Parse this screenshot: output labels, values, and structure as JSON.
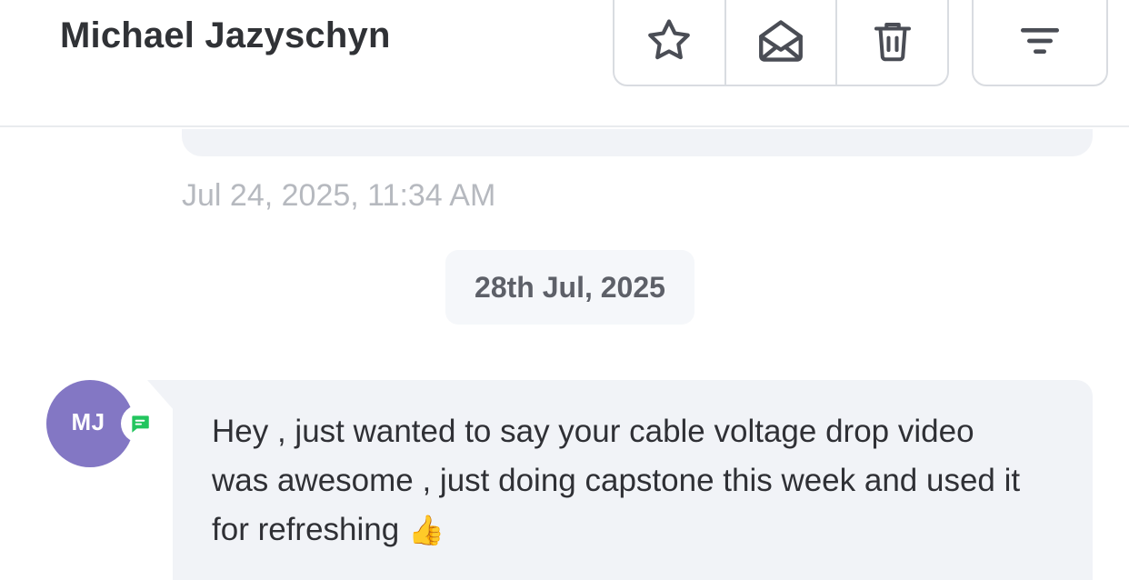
{
  "header": {
    "contact_name": "Michael Jazyschyn",
    "actions": [
      {
        "icon": "star-icon",
        "label": "Star"
      },
      {
        "icon": "envelope-open-icon",
        "label": "Mark as unread"
      },
      {
        "icon": "trash-icon",
        "label": "Delete"
      }
    ],
    "filter_icon": "filter-icon"
  },
  "thread": {
    "previous_timestamp": "Jul 24, 2025, 11:34 AM",
    "date_divider": "28th Jul, 2025",
    "message": {
      "avatar_initials": "MJ",
      "avatar_color": "#8377c4",
      "channel_badge_icon": "chat-bubble-icon",
      "channel_badge_color": "#22c55e",
      "text": "Hey , just wanted to say your cable voltage drop video was awesome , just doing capstone this week and used it for refreshing",
      "emoji": "👍"
    }
  }
}
